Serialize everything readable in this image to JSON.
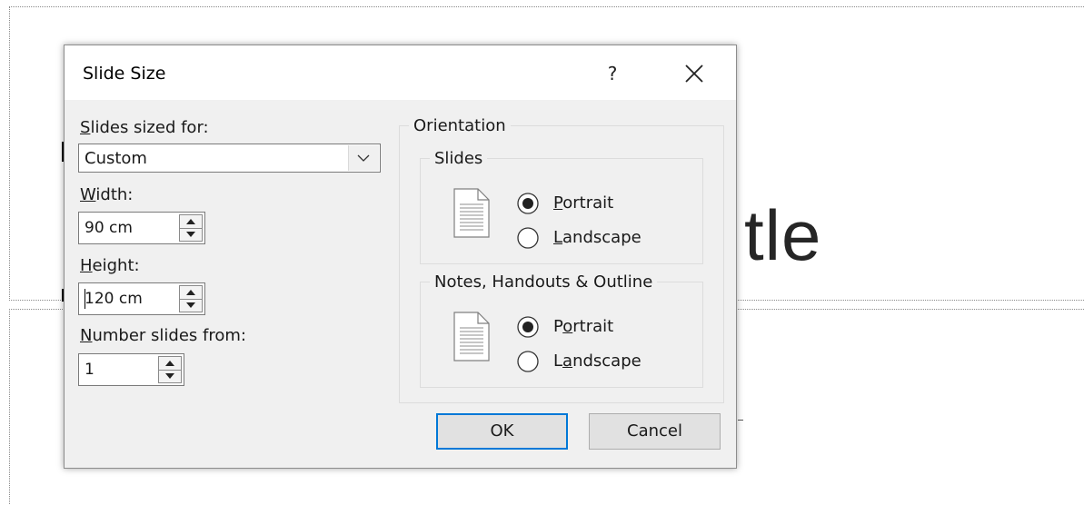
{
  "background": {
    "title_fragment": "tle"
  },
  "dialog": {
    "title": "Slide Size",
    "help_label": "?",
    "left": {
      "slides_sized_for": {
        "label_mn": "S",
        "label_rest": "lides sized for:",
        "selected": "Custom"
      },
      "width": {
        "label_mn": "W",
        "label_rest": "idth:",
        "value": "90 cm"
      },
      "height": {
        "label_mn": "H",
        "label_rest": "eight:",
        "value": "120 cm"
      },
      "number_from": {
        "label_mn": "N",
        "label_rest": "umber slides from:",
        "value": "1"
      }
    },
    "orientation": {
      "group_label": "Orientation",
      "slides": {
        "label": "Slides",
        "portrait": {
          "pre": "",
          "mn": "P",
          "post": "ortrait",
          "checked": true
        },
        "landscape": {
          "pre": "",
          "mn": "L",
          "post": "andscape",
          "checked": false
        }
      },
      "notes": {
        "label": "Notes, Handouts & Outline",
        "portrait": {
          "pre": "P",
          "mn": "o",
          "post": "rtrait",
          "checked": true
        },
        "landscape": {
          "pre": "L",
          "mn": "a",
          "post": "ndscape",
          "checked": false
        }
      }
    },
    "buttons": {
      "ok": "OK",
      "cancel": "Cancel"
    },
    "colors": {
      "focus": "#0078d7",
      "face": "#f0f0f0"
    }
  }
}
